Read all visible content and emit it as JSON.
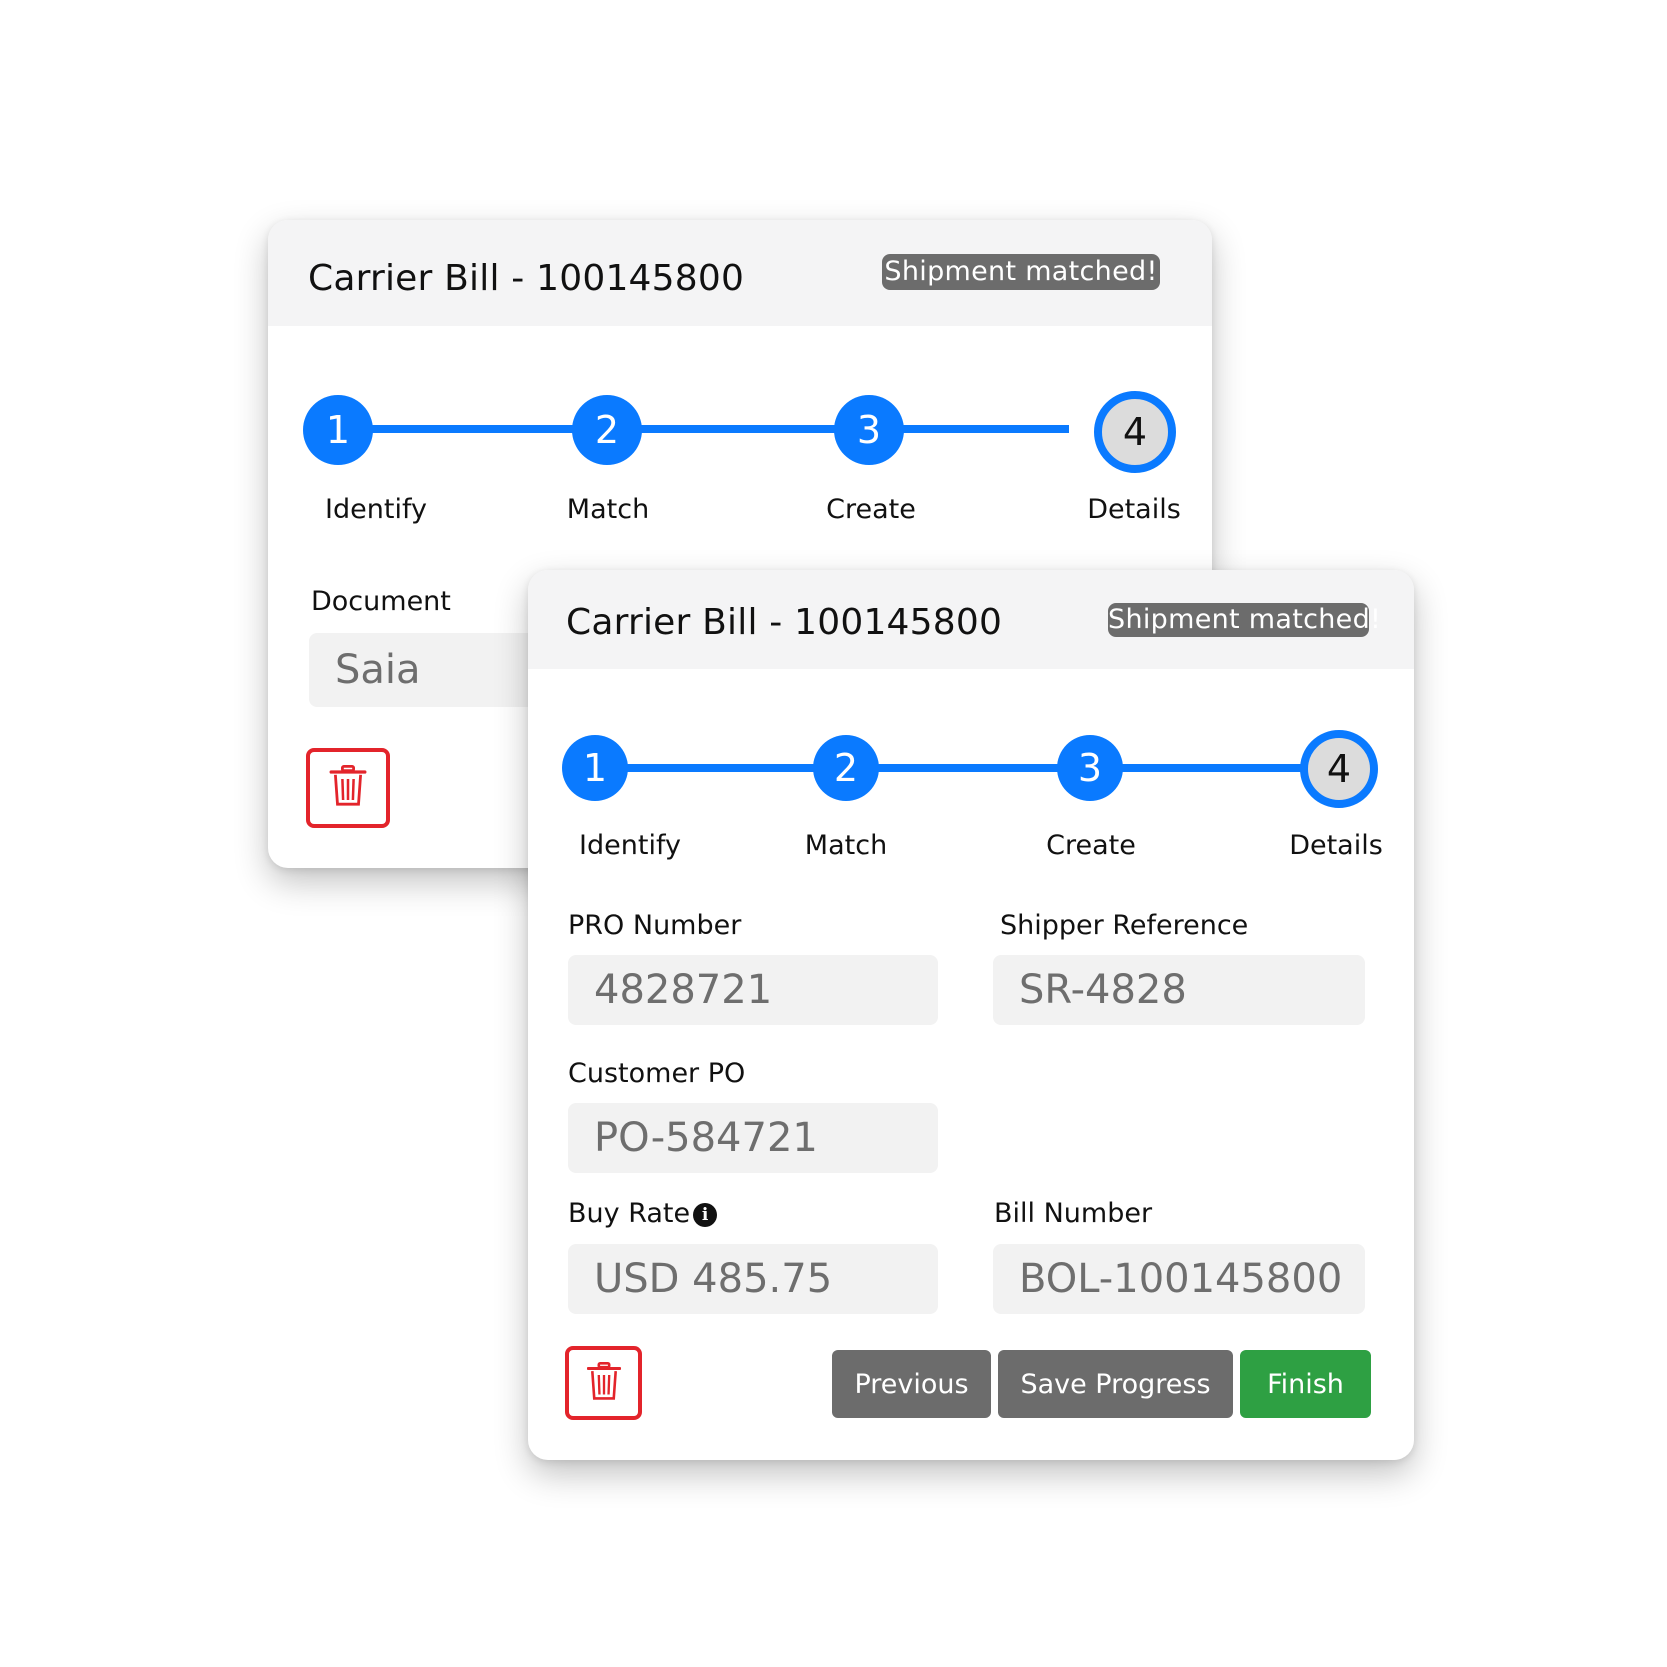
{
  "back_card": {
    "title": "Carrier Bill - 100145800",
    "badge": "Shipment matched!",
    "steps": [
      {
        "number": "1",
        "label": "Identify"
      },
      {
        "number": "2",
        "label": "Match"
      },
      {
        "number": "3",
        "label": "Create"
      },
      {
        "number": "4",
        "label": "Details"
      }
    ],
    "current_step": 4,
    "document": {
      "label": "Document",
      "value": "Saia"
    }
  },
  "front_card": {
    "title": "Carrier Bill - 100145800",
    "badge": "Shipment matched!",
    "steps": [
      {
        "number": "1",
        "label": "Identify"
      },
      {
        "number": "2",
        "label": "Match"
      },
      {
        "number": "3",
        "label": "Create"
      },
      {
        "number": "4",
        "label": "Details"
      }
    ],
    "current_step": 4,
    "fields": {
      "pro_number": {
        "label": "PRO Number",
        "value": "4828721"
      },
      "shipper_reference": {
        "label": "Shipper Reference",
        "value": "SR-4828"
      },
      "customer_po": {
        "label": "Customer PO",
        "value": "PO-584721"
      },
      "buy_rate": {
        "label": "Buy Rate",
        "value": "USD 485.75"
      },
      "bill_number": {
        "label": "Bill Number",
        "value": "BOL-100145800"
      }
    },
    "buttons": {
      "previous": "Previous",
      "save_progress": "Save Progress",
      "finish": "Finish"
    }
  },
  "icons": {
    "delete": "trash-icon",
    "info": "info-icon"
  },
  "colors": {
    "accent": "#0a7aff",
    "badge": "#6c6c6c",
    "secondary_button": "#6c6c6c",
    "finish_button": "#2ea043",
    "delete": "#e3242b",
    "header": "#f4f4f5",
    "input": "#f2f2f2"
  }
}
